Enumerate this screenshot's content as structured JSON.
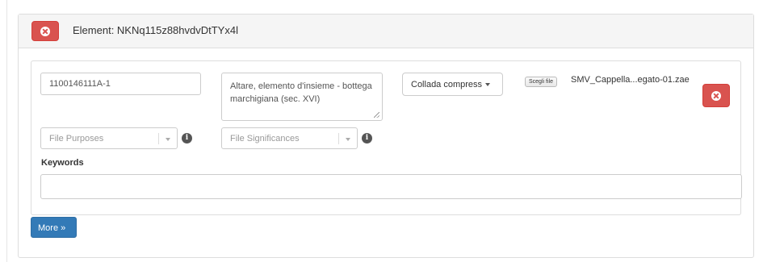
{
  "element": {
    "title": "Element: NKNq115z88hvdvDtTYx4l"
  },
  "form": {
    "id_value": "1100146111A-1",
    "description_value": "Altare, elemento d'insieme - bottega marchigiana (sec. XVI)",
    "format_button_label": "Collada compress",
    "file_button_label": "Scegli file",
    "file_name": "SMV_Cappella...egato-01.zae",
    "purposes_placeholder": "File Purposes",
    "significances_placeholder": "File Significances",
    "info_icon_glyph": "i",
    "keywords_label": "Keywords",
    "keywords_value": ""
  },
  "more_button_label": "More »",
  "colors": {
    "danger": "#d9534f",
    "primary": "#337ab7"
  },
  "icons": [
    "close-icon",
    "close-icon",
    "caret-down-icon",
    "info-icon"
  ]
}
